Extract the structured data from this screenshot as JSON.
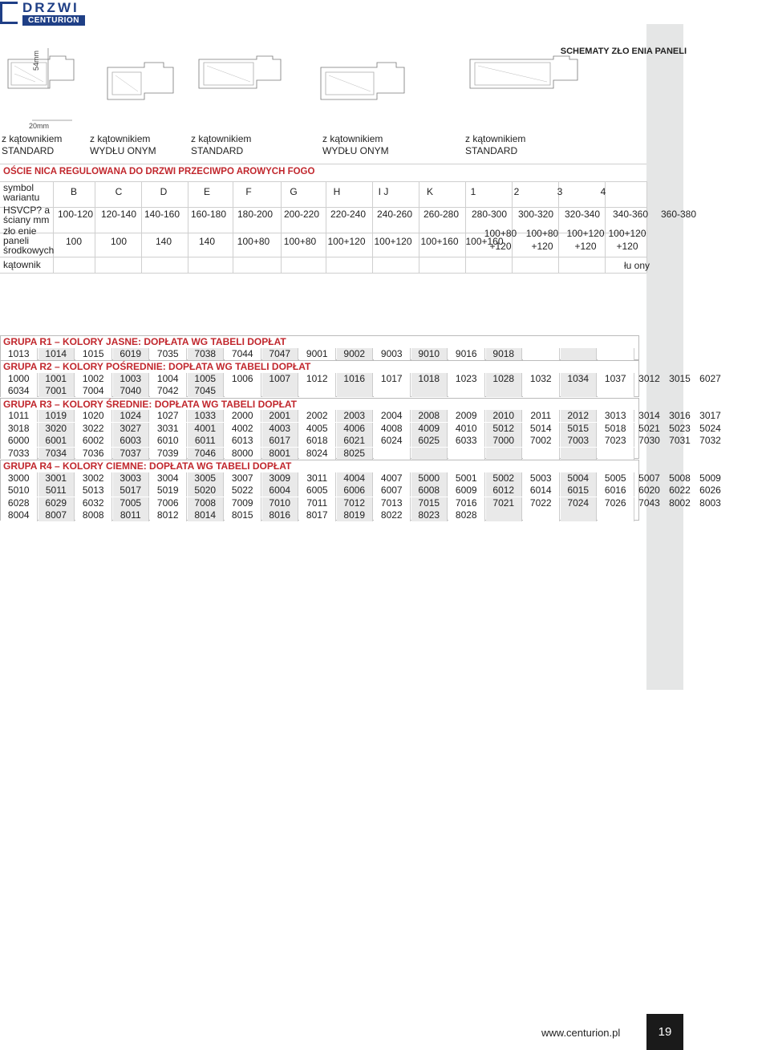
{
  "logo": {
    "brand_top": "DRZWI",
    "brand_bottom": "CENTURION"
  },
  "page_title": "SCHEMATY ZŁO   ENIA PANELI",
  "drawing": {
    "dim_vertical": "54mm",
    "dim_horizontal": "20mm",
    "profiles": [
      {
        "line1": "z kątownikiem",
        "line2": "STANDARD"
      },
      {
        "line1": "z kątownikiem",
        "line2": "WYDŁU  ONYM"
      },
      {
        "line1": "z kątownikiem",
        "line2": "STANDARD"
      },
      {
        "line1": "z kątownikiem",
        "line2": "WYDŁU  ONYM"
      },
      {
        "line1": "z kątownikiem",
        "line2": "STANDARD"
      }
    ]
  },
  "spec_table": {
    "heading": "OŚCIE   NICA REGULOWANA DO DRZWI PRZECIWPO   AROWYCH FOGO",
    "row_labels": {
      "symbol": [
        "symbol",
        "wariantu"
      ],
      "thickness": [
        "HSVCP? a",
        "ściany mm"
      ],
      "panels": [
        "zło  enie",
        "paneli",
        "środkowych"
      ],
      "angle": [
        "kątownik"
      ]
    },
    "symbols": [
      "B",
      "C",
      "D",
      "E",
      "F",
      "G",
      "H",
      "I J",
      "K",
      "1",
      "2",
      "3",
      "4"
    ],
    "thickness": [
      "100-120",
      "120-140",
      "140-160",
      "160-180",
      "180-200",
      "200-220",
      "220-240",
      "240-260",
      "260-280",
      "280-300",
      "300-320",
      "320-340",
      "340-360",
      "360-380"
    ],
    "panels_single": [
      "100",
      "100",
      "140",
      "140",
      "100+80",
      "100+80",
      "100+120",
      "100+120",
      "100+160",
      "100+160"
    ],
    "panels_double": [
      {
        "a": "100+80",
        "b": "+120"
      },
      {
        "a": "100+80",
        "b": "+120"
      },
      {
        "a": "100+120",
        "b": "+120"
      },
      {
        "a": "100+120",
        "b": "+120"
      }
    ],
    "angle_note": "łu  ony"
  },
  "color_groups": [
    {
      "title": "GRUPA R1 – KOLORY JASNE: DOPŁATA WG TABELI DOPŁAT",
      "rows": [
        [
          "1013",
          "1014",
          "1015",
          "6019",
          "7035",
          "7038",
          "7044",
          "7047",
          "9001",
          "9002",
          "9003",
          "9010",
          "9016",
          "9018"
        ]
      ]
    },
    {
      "title": "GRUPA R2 – KOLORY POŚREDNIE: DOPŁATA WG TABELI DOPŁAT",
      "rows": [
        [
          "1000",
          "1001",
          "1002",
          "1003",
          "1004",
          "1005",
          "1006",
          "1007",
          "1012",
          "1016",
          "1017",
          "1018",
          "1023",
          "1028",
          "1032",
          "1034",
          "1037",
          "3012",
          "3015",
          "6027"
        ],
        [
          "6034",
          "7001",
          "7004",
          "7040",
          "7042",
          "7045"
        ]
      ]
    },
    {
      "title": "GRUPA R3 – KOLORY ŚREDNIE: DOPŁATA WG TABELI DOPŁAT",
      "rows": [
        [
          "1011",
          "1019",
          "1020",
          "1024",
          "1027",
          "1033",
          "2000",
          "2001",
          "2002",
          "2003",
          "2004",
          "2008",
          "2009",
          "2010",
          "2011",
          "2012",
          "3013",
          "3014",
          "3016",
          "3017"
        ],
        [
          "3018",
          "3020",
          "3022",
          "3027",
          "3031",
          "4001",
          "4002",
          "4003",
          "4005",
          "4006",
          "4008",
          "4009",
          "4010",
          "5012",
          "5014",
          "5015",
          "5018",
          "5021",
          "5023",
          "5024"
        ],
        [
          "6000",
          "6001",
          "6002",
          "6003",
          "6010",
          "6011",
          "6013",
          "6017",
          "6018",
          "6021",
          "6024",
          "6025",
          "6033",
          "7000",
          "7002",
          "7003",
          "7023",
          "7030",
          "7031",
          "7032"
        ],
        [
          "7033",
          "7034",
          "7036",
          "7037",
          "7039",
          "7046",
          "8000",
          "8001",
          "8024",
          "8025"
        ]
      ]
    },
    {
      "title": "GRUPA R4 – KOLORY CIEMNE: DOPŁATA WG TABELI DOPŁAT",
      "rows": [
        [
          "3000",
          "3001",
          "3002",
          "3003",
          "3004",
          "3005",
          "3007",
          "3009",
          "3011",
          "4004",
          "4007",
          "5000",
          "5001",
          "5002",
          "5003",
          "5004",
          "5005",
          "5007",
          "5008",
          "5009"
        ],
        [
          "5010",
          "5011",
          "5013",
          "5017",
          "5019",
          "5020",
          "5022",
          "6004",
          "6005",
          "6006",
          "6007",
          "6008",
          "6009",
          "6012",
          "6014",
          "6015",
          "6016",
          "6020",
          "6022",
          "6026"
        ],
        [
          "6028",
          "6029",
          "6032",
          "7005",
          "7006",
          "7008",
          "7009",
          "7010",
          "7011",
          "7012",
          "7013",
          "7015",
          "7016",
          "7021",
          "7022",
          "7024",
          "7026",
          "7043",
          "8002",
          "8003"
        ],
        [
          "8004",
          "8007",
          "8008",
          "8011",
          "8012",
          "8014",
          "8015",
          "8016",
          "8017",
          "8019",
          "8022",
          "8023",
          "8028"
        ]
      ]
    }
  ],
  "footer": {
    "url": "www.centurion.pl",
    "page_number": "19"
  }
}
